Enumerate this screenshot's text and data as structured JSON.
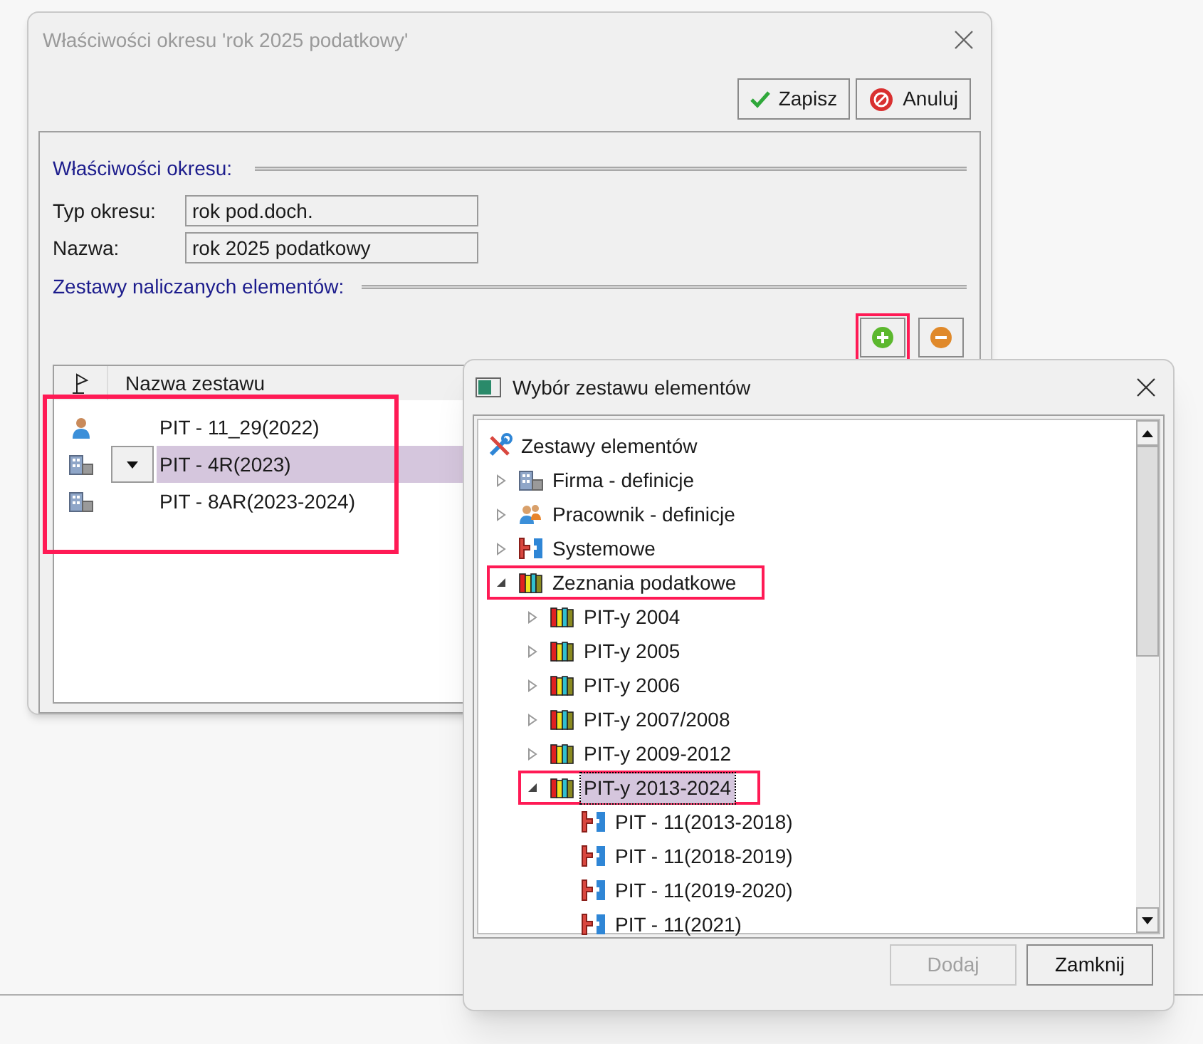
{
  "main_window": {
    "title": "Właściwości okresu 'rok 2025 podatkowy'",
    "buttons": [
      {
        "label": "Zapisz",
        "kind": "save"
      },
      {
        "label": "Anuluj",
        "kind": "cancel"
      }
    ],
    "properties_section": {
      "title": "Właściwości okresu:",
      "fields": [
        {
          "label": "Typ okresu:",
          "value": "rok pod.doch."
        },
        {
          "label": "Nazwa:",
          "value": "rok 2025 podatkowy"
        }
      ]
    },
    "sets_section": {
      "title": "Zestawy naliczanych elementów:",
      "add_highlighted": true
    },
    "table": {
      "column": "Nazwa zestawu",
      "highlighted": true,
      "rows": [
        {
          "name": "PIT - 11_29(2022)",
          "kind": "person",
          "selected": false
        },
        {
          "name": "PIT - 4R(2023)",
          "kind": "building",
          "selected": true
        },
        {
          "name": "PIT - 8AR(2023-2024)",
          "kind": "building",
          "selected": false
        }
      ]
    }
  },
  "dialog": {
    "title": "Wybór zestawu elementów",
    "tree": {
      "items": [
        {
          "label": "Zestawy elementów",
          "kind": "tools",
          "selected": false,
          "highlighted": false,
          "children": [
            {
              "label": "Firma - definicje",
              "kind": "building",
              "expanded": false,
              "selected": false,
              "highlighted": false
            },
            {
              "label": "Pracownik - definicje",
              "kind": "people",
              "expanded": false,
              "selected": false,
              "highlighted": false
            },
            {
              "label": "Systemowe",
              "kind": "system",
              "expanded": false,
              "selected": false,
              "highlighted": false
            },
            {
              "label": "Zeznania podatkowe",
              "kind": "books",
              "expanded": true,
              "selected": false,
              "highlighted": true,
              "children": [
                {
                  "label": "PIT-y 2004",
                  "kind": "books",
                  "expanded": false,
                  "selected": false,
                  "highlighted": false
                },
                {
                  "label": "PIT-y 2005",
                  "kind": "books",
                  "expanded": false,
                  "selected": false,
                  "highlighted": false
                },
                {
                  "label": "PIT-y 2006",
                  "kind": "books",
                  "expanded": false,
                  "selected": false,
                  "highlighted": false
                },
                {
                  "label": "PIT-y 2007/2008",
                  "kind": "books",
                  "expanded": false,
                  "selected": false,
                  "highlighted": false
                },
                {
                  "label": "PIT-y 2009-2012",
                  "kind": "books",
                  "expanded": false,
                  "selected": false,
                  "highlighted": false
                },
                {
                  "label": "PIT-y 2013-2024",
                  "kind": "books",
                  "expanded": true,
                  "selected": true,
                  "highlighted": true,
                  "children": [
                    {
                      "label": "PIT - 11(2013-2018)",
                      "kind": "system",
                      "selected": false,
                      "highlighted": false
                    },
                    {
                      "label": "PIT - 11(2018-2019)",
                      "kind": "system",
                      "selected": false,
                      "highlighted": false
                    },
                    {
                      "label": "PIT - 11(2019-2020)",
                      "kind": "system",
                      "selected": false,
                      "highlighted": false
                    },
                    {
                      "label": "PIT - 11(2021)",
                      "kind": "system",
                      "selected": false,
                      "highlighted": false
                    }
                  ]
                }
              ]
            }
          ]
        }
      ]
    },
    "buttons": [
      {
        "label": "Dodaj",
        "disabled": true
      },
      {
        "label": "Zamknij",
        "disabled": false
      }
    ]
  }
}
